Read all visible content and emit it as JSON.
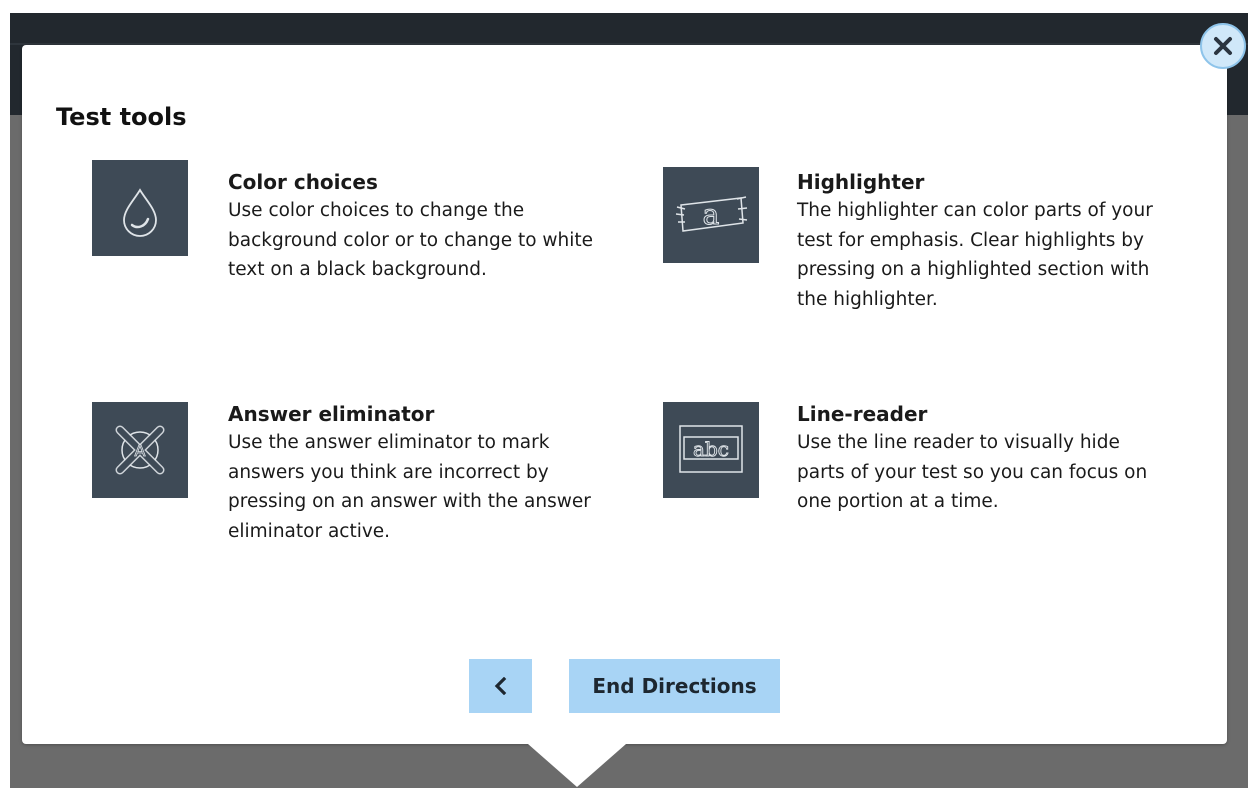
{
  "dialog": {
    "title": "Test tools",
    "close_icon": "close-icon"
  },
  "tools": [
    {
      "name": "Color choices",
      "description": "Use color choices to change the background color or to change to white text on a black background.",
      "icon": "droplet-icon"
    },
    {
      "name": "Highlighter",
      "description": "The highlighter can color parts of your test for emphasis. Clear highlights by pressing on a highlighted section with the highlighter.",
      "icon": "highlighter-icon"
    },
    {
      "name": "Answer eliminator",
      "description": "Use the answer eliminator to mark answers you think are incorrect by pressing on an answer with the answer eliminator active.",
      "icon": "answer-eliminator-icon"
    },
    {
      "name": "Line-reader",
      "description": "Use the line reader to visually hide parts of your test so you can focus on one portion at a time.",
      "icon": "line-reader-icon"
    }
  ],
  "footer": {
    "back_icon": "chevron-left-icon",
    "end_label": "End Directions"
  },
  "colors": {
    "icon_tile": "#3e4a56",
    "button": "#a8d4f5",
    "backdrop": "#6b6b6b",
    "header_bar": "#22282e"
  }
}
